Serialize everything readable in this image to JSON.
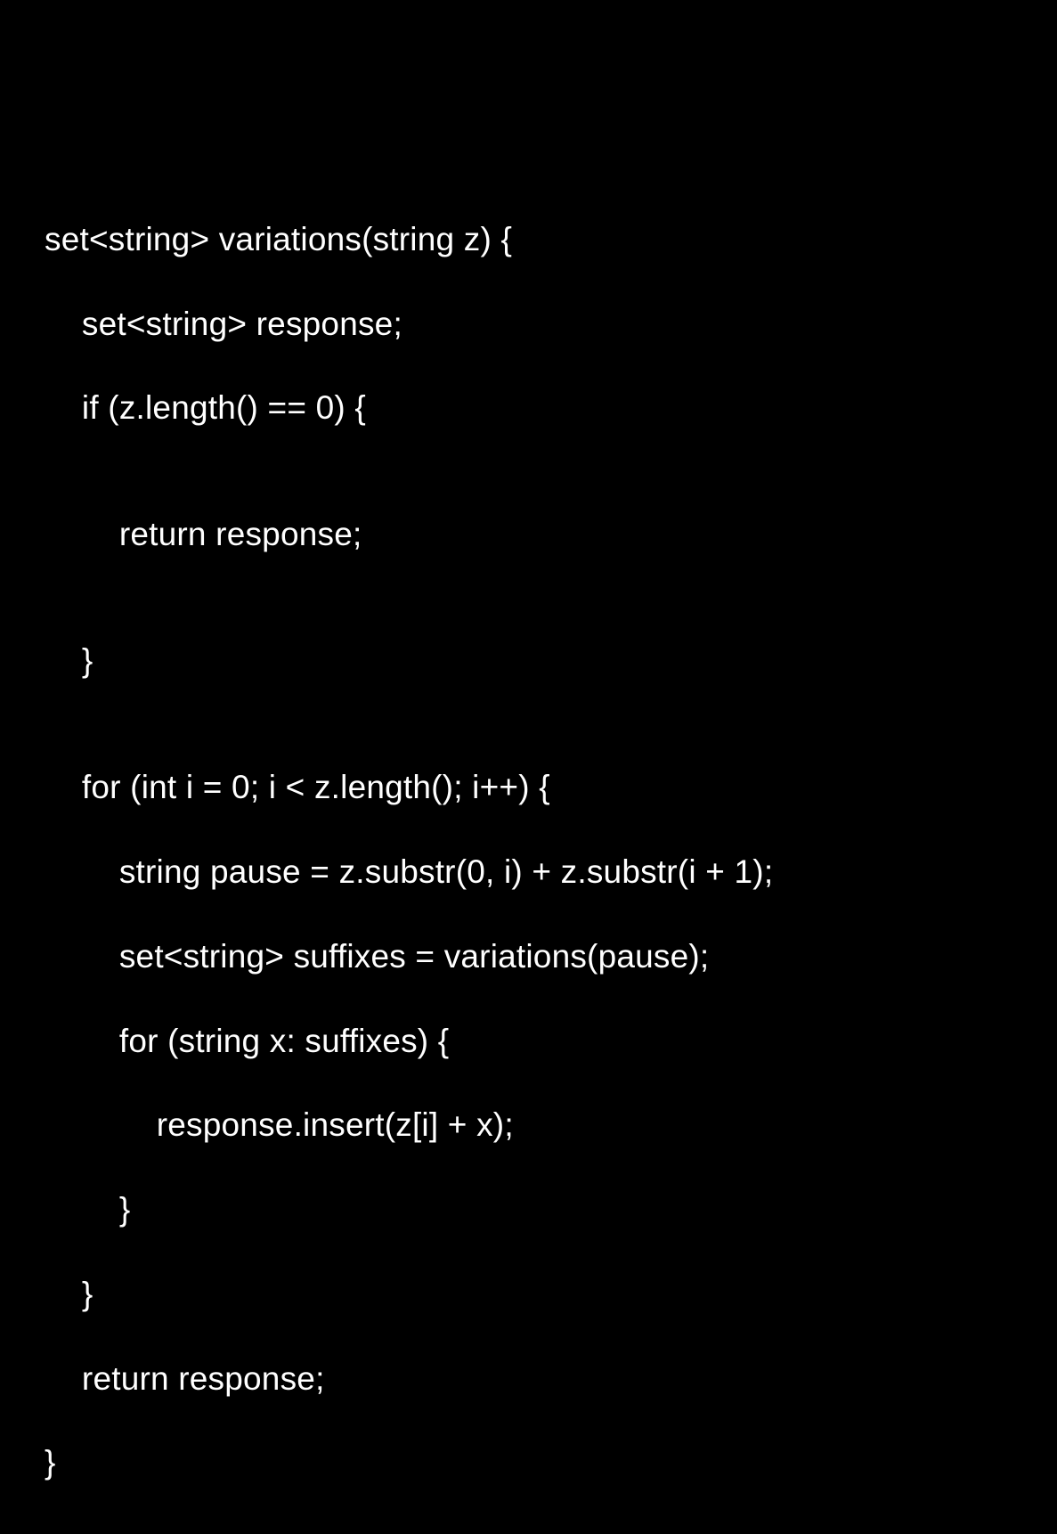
{
  "code": {
    "lines": [
      "set<string> variations(string z) {",
      "    set<string> response;",
      "    if (z.length() == 0) {",
      "",
      "        return response;",
      "",
      "    }",
      "",
      "    for (int i = 0; i < z.length(); i++) {",
      "        string pause = z.substr(0, i) + z.substr(i + 1);",
      "        set<string> suffixes = variations(pause);",
      "        for (string x: suffixes) {",
      "            response.insert(z[i] + x);",
      "        }",
      "    }",
      "    return response;",
      "}"
    ]
  }
}
